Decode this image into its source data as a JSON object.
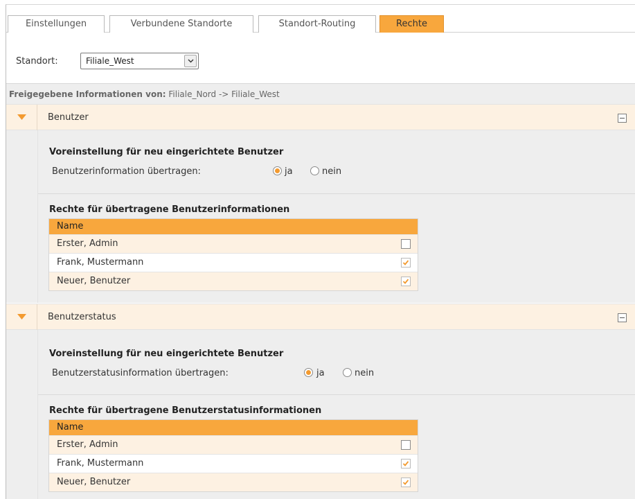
{
  "tabs": [
    {
      "label": "Einstellungen",
      "active": false
    },
    {
      "label": "Verbundene Standorte",
      "active": false
    },
    {
      "label": "Standort-Routing",
      "active": false
    },
    {
      "label": "Rechte",
      "active": true
    }
  ],
  "standort": {
    "label": "Standort:",
    "selected": "Filiale_West"
  },
  "info": {
    "prefix": "Freigegebene Informationen von:",
    "text": "Filiale_Nord -> Filiale_West"
  },
  "sections": [
    {
      "title": "Benutzer",
      "default_heading": "Voreinstellung für neu eingerichtete Benutzer",
      "option_label": "Benutzerinformation übertragen:",
      "radio_yes": "ja",
      "radio_no": "nein",
      "selected": "ja",
      "rights_heading": "Rechte für übertragene Benutzerinformationen",
      "column": "Name",
      "rows": [
        {
          "name": "Erster, Admin",
          "checked": false
        },
        {
          "name": "Frank, Mustermann",
          "checked": true
        },
        {
          "name": "Neuer, Benutzer",
          "checked": true
        }
      ]
    },
    {
      "title": "Benutzerstatus",
      "default_heading": "Voreinstellung für neu eingerichtete Benutzer",
      "option_label": "Benutzerstatusinformation übertragen:",
      "radio_yes": "ja",
      "radio_no": "nein",
      "selected": "ja",
      "rights_heading": "Rechte für übertragene Benutzerstatusinformationen",
      "column": "Name",
      "rows": [
        {
          "name": "Erster, Admin",
          "checked": false
        },
        {
          "name": "Frank, Mustermann",
          "checked": true
        },
        {
          "name": "Neuer, Benutzer",
          "checked": true
        }
      ]
    }
  ],
  "colors": {
    "accent": "#f8a73d",
    "row_alt": "#fdf1e2",
    "panel": "#eeeeee"
  }
}
